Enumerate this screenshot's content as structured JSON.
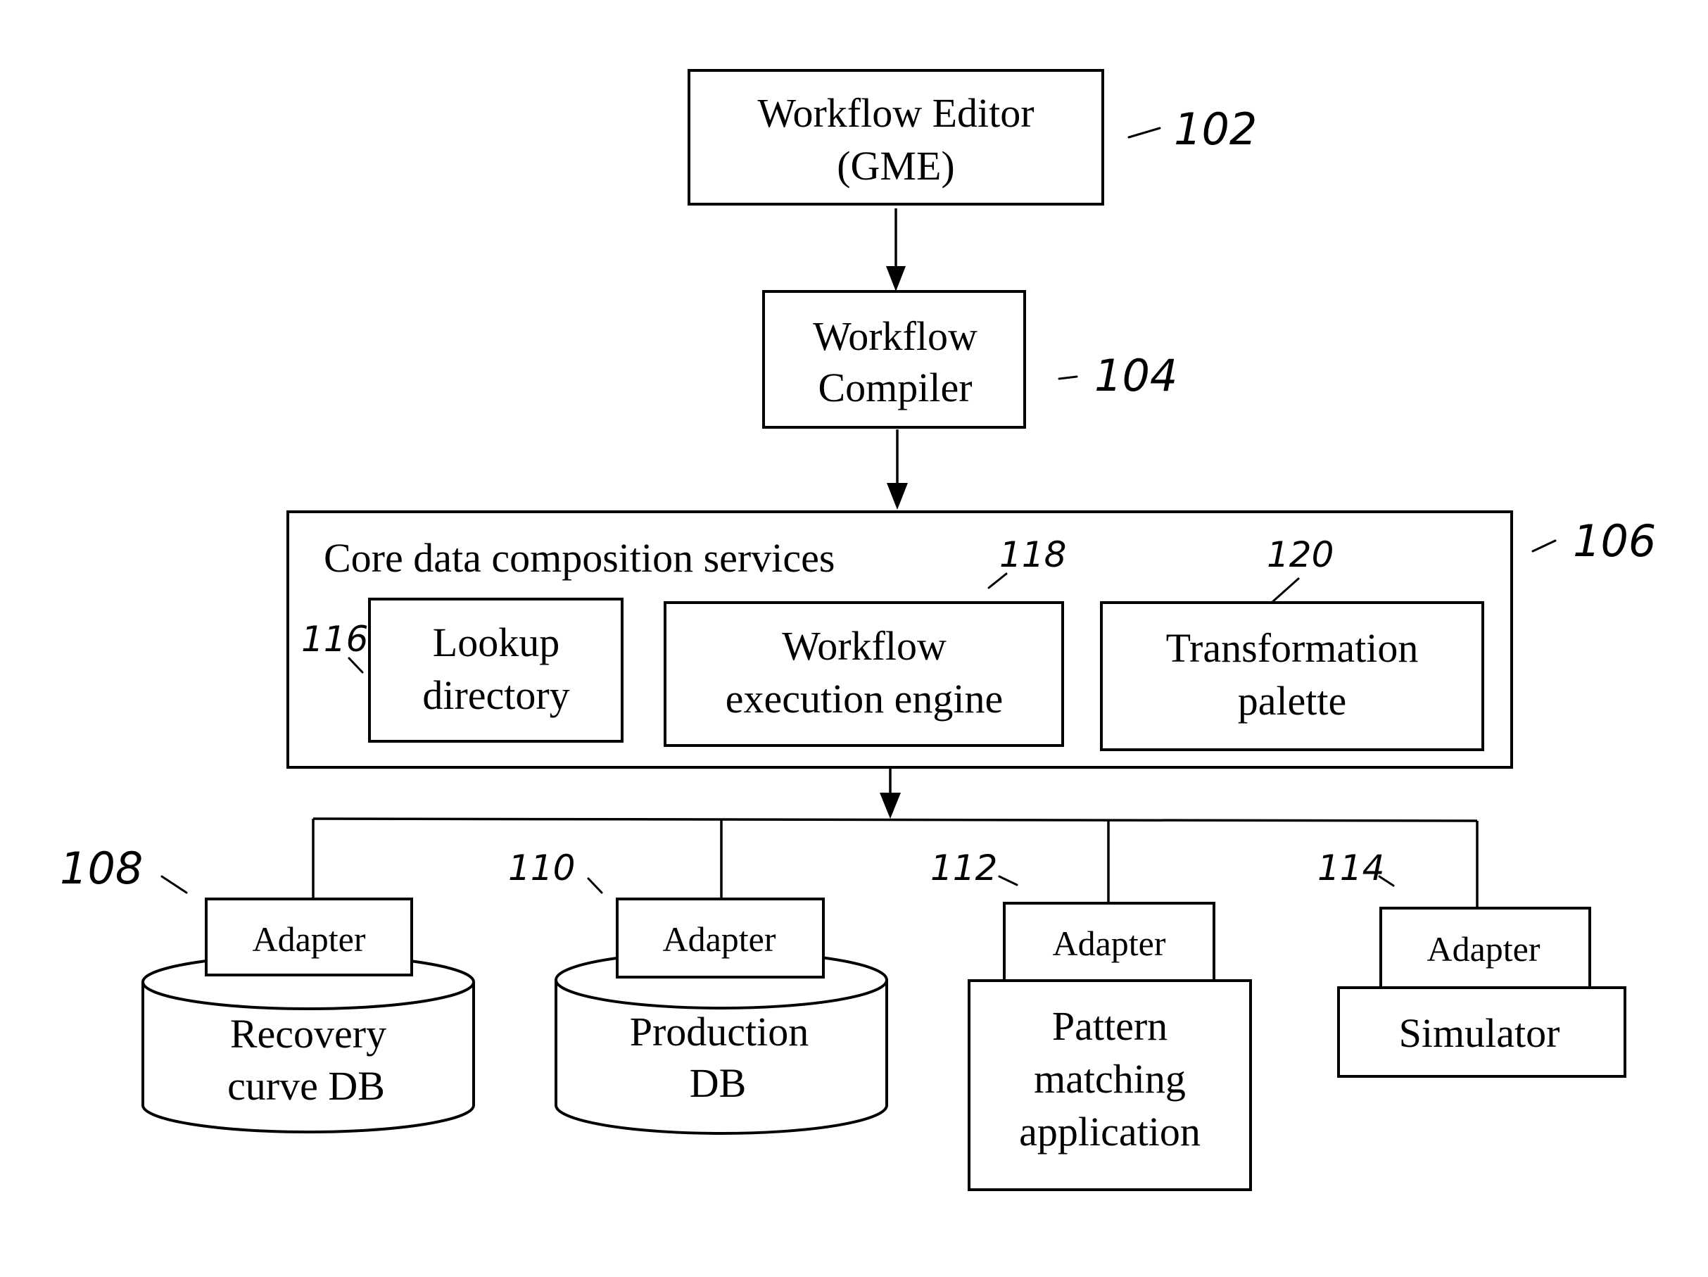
{
  "diagram": {
    "type": "block-diagram",
    "nodes": {
      "workflow_editor": {
        "lines": [
          "Workflow Editor",
          "(GME)"
        ],
        "ref": "102"
      },
      "workflow_compiler": {
        "lines": [
          "Workflow",
          "Compiler"
        ],
        "ref": "104"
      },
      "core_services": {
        "title": "Core data composition services",
        "ref": "106",
        "components": [
          {
            "id": "lookup_directory",
            "lines": [
              "Lookup",
              "directory"
            ],
            "ref": "116"
          },
          {
            "id": "workflow_execution_engine",
            "lines": [
              "Workflow",
              "execution engine"
            ],
            "ref": "118"
          },
          {
            "id": "transformation_palette",
            "lines": [
              "Transformation",
              "palette"
            ],
            "ref": "120"
          }
        ]
      },
      "targets": [
        {
          "id": "recovery_curve_db",
          "shape": "cylinder",
          "adapter": "Adapter",
          "lines": [
            "Recovery",
            "curve DB"
          ],
          "ref": "108"
        },
        {
          "id": "production_db",
          "shape": "cylinder",
          "adapter": "Adapter",
          "lines": [
            "Production",
            "DB"
          ],
          "ref": "110"
        },
        {
          "id": "pattern_matching_application",
          "shape": "box",
          "adapter": "Adapter",
          "lines": [
            "Pattern",
            "matching",
            "application"
          ],
          "ref": "112"
        },
        {
          "id": "simulator",
          "shape": "box",
          "adapter": "Adapter",
          "lines": [
            "Simulator"
          ],
          "ref": "114"
        }
      ]
    },
    "edges": [
      {
        "from": "workflow_editor",
        "to": "workflow_compiler",
        "arrow": true
      },
      {
        "from": "workflow_compiler",
        "to": "core_services",
        "arrow": true
      },
      {
        "from": "core_services",
        "to": [
          "recovery_curve_db",
          "production_db",
          "pattern_matching_application",
          "simulator"
        ],
        "arrow": true,
        "style": "bus"
      }
    ]
  }
}
